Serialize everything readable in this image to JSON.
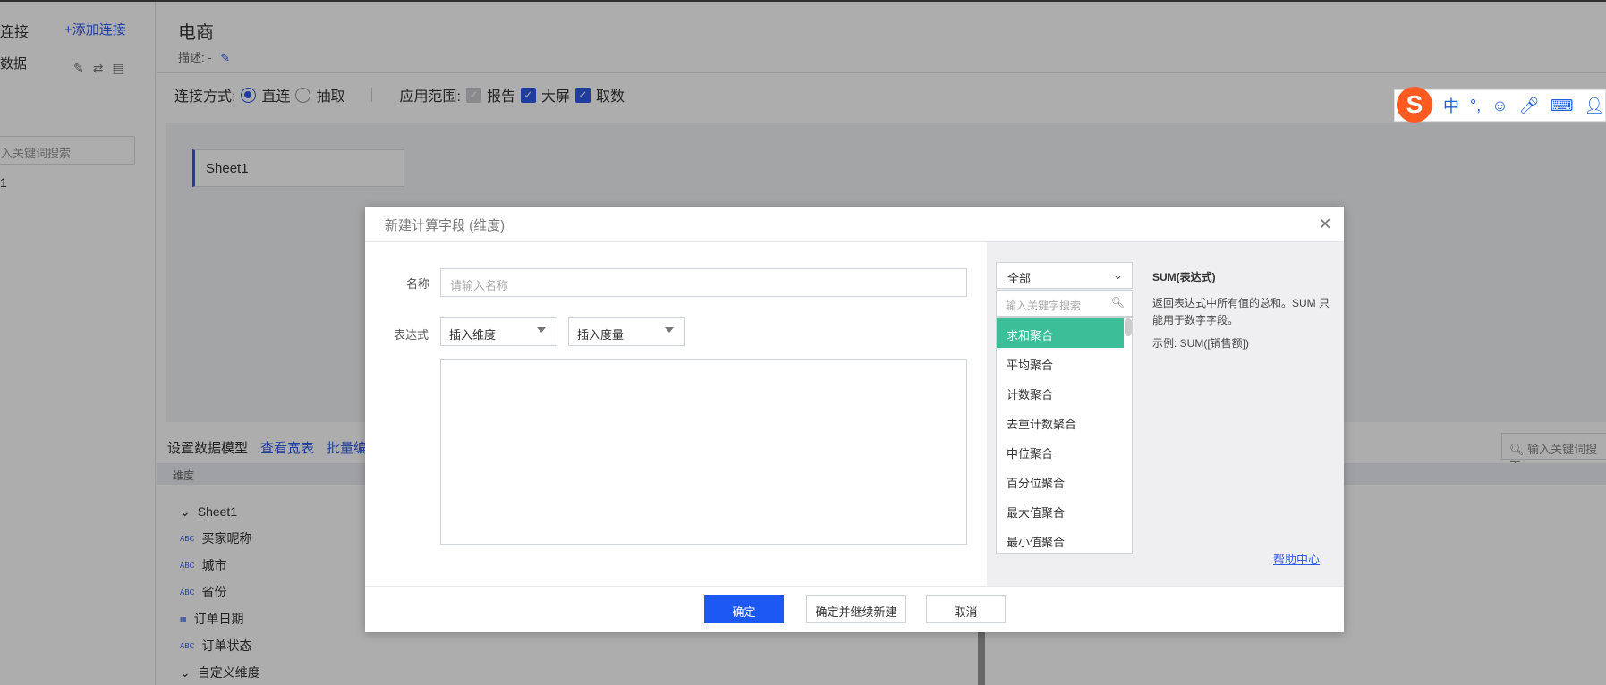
{
  "sidebar": {
    "title": "连接",
    "add_connection": "+添加连接",
    "data_label": "数据",
    "search_placeholder": "入关键词搜索",
    "item": "1"
  },
  "header": {
    "title": "电商",
    "desc_label": "描述: -"
  },
  "connection": {
    "mode_label": "连接方式:",
    "direct": "直连",
    "extract": "抽取",
    "scope_label": "应用范围:",
    "report": "报告",
    "bigscreen": "大屏",
    "fetch": "取数"
  },
  "canvas": {
    "sheet_name": "Sheet1"
  },
  "model": {
    "setup": "设置数据模型",
    "view_wide": "查看宽表",
    "batch": "批量编",
    "dim_header": "维度",
    "search_placeholder": "输入关键词搜索"
  },
  "tree": {
    "group": "Sheet1",
    "fields": [
      "买家昵称",
      "城市",
      "省份",
      "订单日期",
      "订单状态"
    ],
    "custom_group": "自定义维度"
  },
  "ime": {
    "logo": "S",
    "lang": "中"
  },
  "dialog": {
    "title": "新建计算字段 (维度)",
    "name_label": "名称",
    "name_placeholder": "请输入名称",
    "expr_label": "表达式",
    "insert_dim": "插入维度",
    "insert_measure": "插入度量",
    "category": "全部",
    "func_search_placeholder": "输入关键字搜索",
    "functions": [
      "求和聚合",
      "平均聚合",
      "计数聚合",
      "去重计数聚合",
      "中位聚合",
      "百分位聚合",
      "最大值聚合",
      "最小值聚合"
    ],
    "doc_title": "SUM(表达式)",
    "doc_body": "返回表达式中所有值的总和。SUM 只能用于数字字段。",
    "doc_example": "示例: SUM([销售额])",
    "help": "帮助中心",
    "ok": "确定",
    "ok_continue": "确定并继续新建",
    "cancel": "取消"
  },
  "colors": {
    "accent": "#2f5bea",
    "selected": "#3cbf99",
    "primary_button": "#1c58f2"
  }
}
